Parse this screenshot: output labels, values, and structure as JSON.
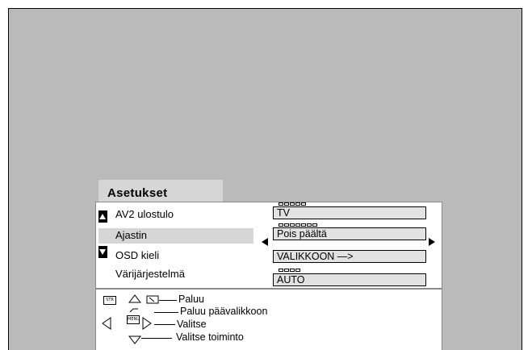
{
  "menu": {
    "title": "Asetukset",
    "rows": [
      {
        "label": "AV2 ulostulo",
        "value": "TV"
      },
      {
        "label": "Ajastin",
        "value": "Pois päältä"
      },
      {
        "label": "OSD kieli",
        "value": "VALIKKOON —>"
      },
      {
        "label": "Värijärjestelmä",
        "value": "AUTO"
      }
    ]
  },
  "help": {
    "back": "Paluu",
    "main_menu": "Paluu päävalikkoon",
    "select": "Valitse",
    "select_function": "Valitse toiminto",
    "str_key": "STR",
    "menu_key": "MENU"
  },
  "icons": {
    "up": "up-arrow-icon",
    "down": "down-arrow-icon",
    "left": "left-triangle-icon",
    "right": "right-triangle-icon"
  }
}
